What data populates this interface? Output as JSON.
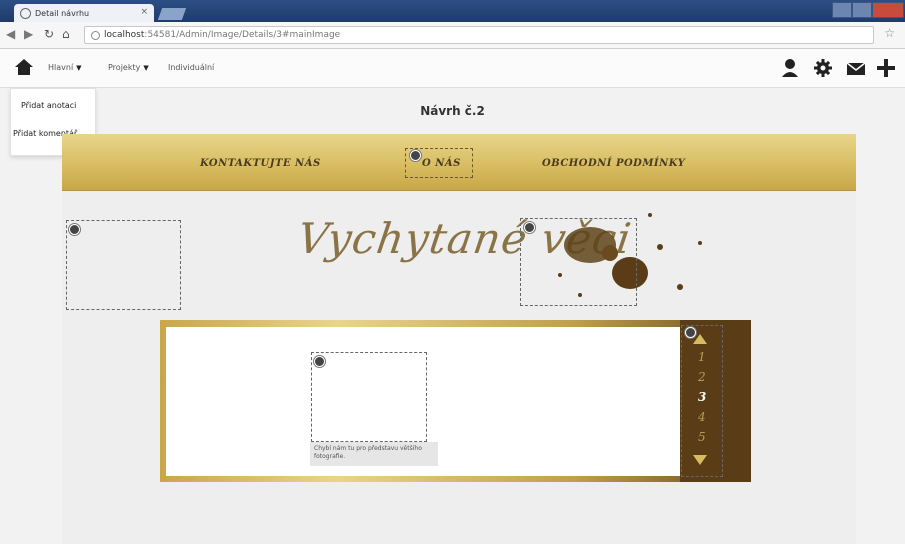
{
  "browser": {
    "tab_title": "Detail návrhu",
    "tab_close": "×",
    "url_host": "localhost",
    "url_rest": ":54581/Admin/Image/Details/3#mainImage"
  },
  "toolbar": {
    "menu": [
      {
        "label": "Hlavní",
        "caret": "▼"
      },
      {
        "label": "Projekty",
        "caret": "▼"
      },
      {
        "label": "Individuální",
        "caret": ""
      }
    ]
  },
  "dropdown": {
    "items": [
      "Přidat anotaci",
      "Přidat komentář"
    ]
  },
  "page": {
    "title": "Návrh č.2"
  },
  "design": {
    "nav": [
      "Kontaktujte nás",
      "O nás",
      "Obchodní podmínky"
    ],
    "logo_text": "Vychytané věci",
    "slider_numbers": [
      "1",
      "2",
      "3",
      "4",
      "5"
    ],
    "active_slide": "3",
    "caption": "Chybí nám tu pro představu většího fotografie."
  },
  "colors": {
    "gold": "#d7bb5f",
    "dark_brown": "#5a3d16",
    "chrome_blue": "#2c4f86"
  }
}
